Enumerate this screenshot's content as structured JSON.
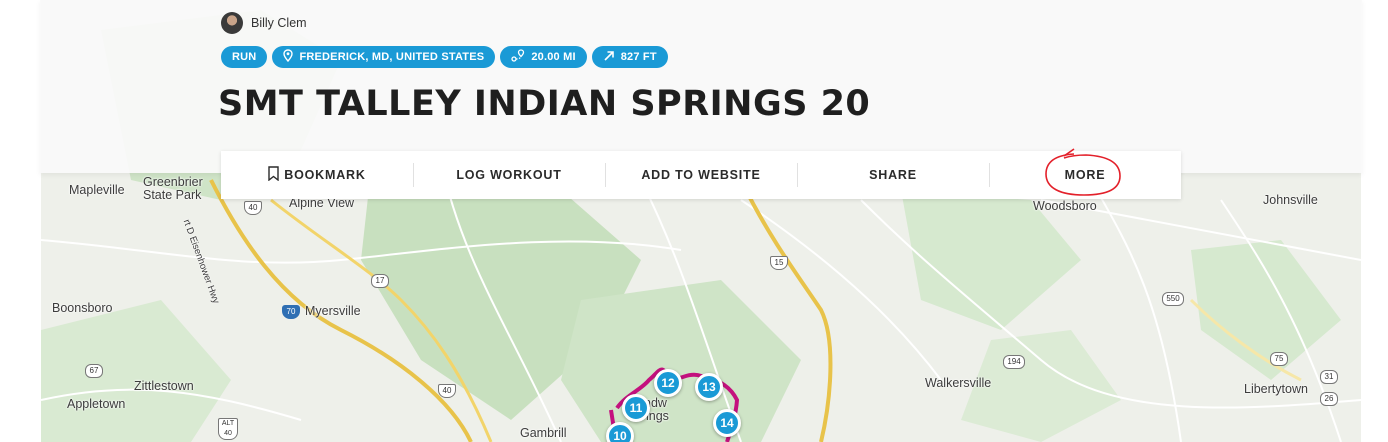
{
  "author": {
    "name": "Billy Clem"
  },
  "tags": [
    {
      "icon": "none",
      "label": "RUN"
    },
    {
      "icon": "location-pin-icon",
      "label": "FREDERICK, MD, UNITED STATES"
    },
    {
      "icon": "route-icon",
      "label": "20.00 MI"
    },
    {
      "icon": "elevation-arrow-icon",
      "label": "827 FT"
    }
  ],
  "title": "SMT TALLEY INDIAN SPRINGS 20",
  "actions": [
    {
      "icon": "bookmark-icon",
      "label": "BOOKMARK"
    },
    {
      "label": "LOG WORKOUT"
    },
    {
      "label": "ADD TO WEBSITE"
    },
    {
      "label": "SHARE"
    },
    {
      "label": "MORE"
    }
  ],
  "colors": {
    "accent": "#1a9ad6",
    "route": "#c4117e",
    "annotation": "#e3202a"
  },
  "map": {
    "places": [
      "Mapleville",
      "Greenbrier",
      "State Park",
      "Alpine View",
      "Boonsboro",
      "Myersville",
      "Zittlestown",
      "Appletown",
      "Gambrill",
      "Woodsboro",
      "Johnsville",
      "Walkersville",
      "Libertytown",
      "ndw",
      "ings",
      "rt D Eisenhower Hwy"
    ],
    "shields": [
      "40",
      "17",
      "70",
      "67",
      "40",
      "ALT 40",
      "15",
      "550",
      "194",
      "75",
      "31",
      "26"
    ],
    "markers": [
      "10",
      "11",
      "12",
      "13",
      "14"
    ]
  }
}
